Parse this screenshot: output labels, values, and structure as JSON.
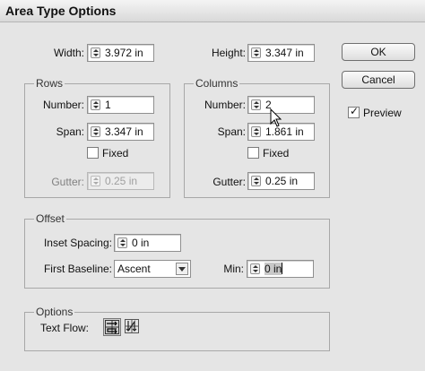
{
  "dialog": {
    "title": "Area Type Options"
  },
  "size": {
    "width_label": "Width:",
    "width_value": "3.972 in",
    "height_label": "Height:",
    "height_value": "3.347 in"
  },
  "rows": {
    "legend": "Rows",
    "number_label": "Number:",
    "number_value": "1",
    "span_label": "Span:",
    "span_value": "3.347 in",
    "fixed_label": "Fixed",
    "fixed_checked": false,
    "gutter_label": "Gutter:",
    "gutter_value": "0.25 in"
  },
  "columns": {
    "legend": "Columns",
    "number_label": "Number:",
    "number_value": "2",
    "span_label": "Span:",
    "span_value": "1.861 in",
    "fixed_label": "Fixed",
    "fixed_checked": false,
    "gutter_label": "Gutter:",
    "gutter_value": "0.25 in"
  },
  "offset": {
    "legend": "Offset",
    "inset_label": "Inset Spacing:",
    "inset_value": "0 in",
    "first_baseline_label": "First Baseline:",
    "first_baseline_value": "Ascent",
    "min_label": "Min:",
    "min_value": "0 in"
  },
  "options": {
    "legend": "Options",
    "text_flow_label": "Text Flow:",
    "text_flow_selected": "rows-first-icon"
  },
  "buttons": {
    "ok": "OK",
    "cancel": "Cancel"
  },
  "preview": {
    "label": "Preview",
    "checked": true
  }
}
